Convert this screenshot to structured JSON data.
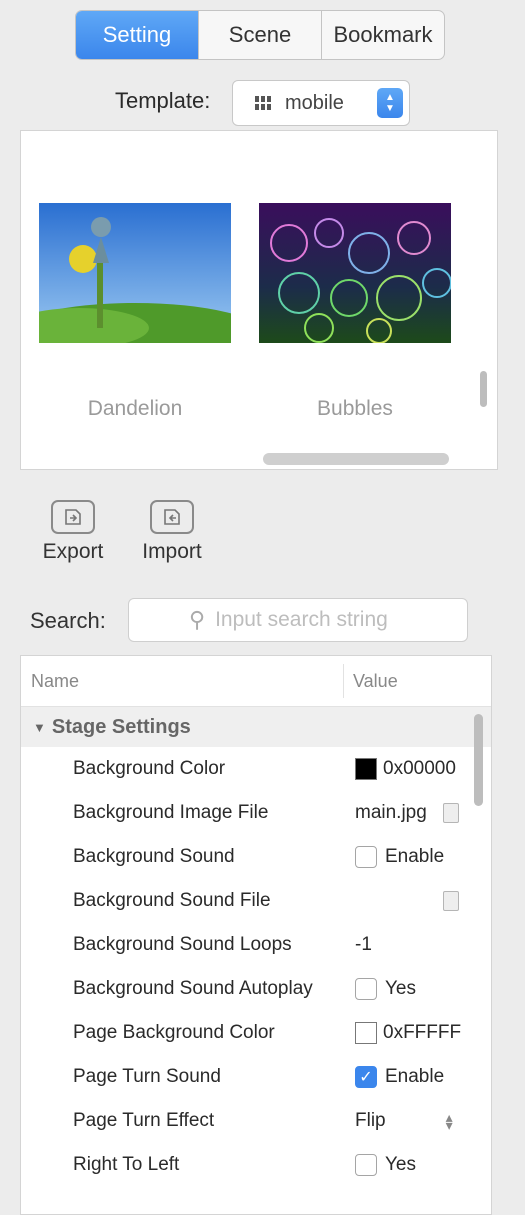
{
  "tabs": [
    {
      "label": "Setting",
      "active": true
    },
    {
      "label": "Scene",
      "active": false
    },
    {
      "label": "Bookmark",
      "active": false
    }
  ],
  "template": {
    "label": "Template:",
    "value": "mobile"
  },
  "gallery": [
    {
      "caption": "Dandelion"
    },
    {
      "caption": "Bubbles"
    }
  ],
  "tools": {
    "export_label": "Export",
    "import_label": "Import"
  },
  "search": {
    "label": "Search:",
    "placeholder": "Input search string"
  },
  "grid": {
    "col_name": "Name",
    "col_value": "Value",
    "group": "Stage Settings",
    "rows": [
      {
        "name": "Background Color",
        "value": "0x00000",
        "kind": "color",
        "color": "#000000"
      },
      {
        "name": "Background Image File",
        "value": "main.jpg",
        "kind": "file"
      },
      {
        "name": "Background Sound",
        "value": "Enable",
        "kind": "check",
        "checked": false
      },
      {
        "name": "Background Sound File",
        "value": "",
        "kind": "file"
      },
      {
        "name": "Background Sound Loops",
        "value": "-1",
        "kind": "text"
      },
      {
        "name": "Background Sound Autoplay",
        "value": "Yes",
        "kind": "check",
        "checked": false
      },
      {
        "name": "Page Background Color",
        "value": "0xFFFFF",
        "kind": "color",
        "color": "#ffffff"
      },
      {
        "name": "Page Turn Sound",
        "value": "Enable",
        "kind": "check",
        "checked": true
      },
      {
        "name": "Page Turn Effect",
        "value": "Flip",
        "kind": "select"
      },
      {
        "name": "Right To Left",
        "value": "Yes",
        "kind": "check",
        "checked": false
      }
    ]
  },
  "colors": {
    "accent": "#3b86ec"
  }
}
